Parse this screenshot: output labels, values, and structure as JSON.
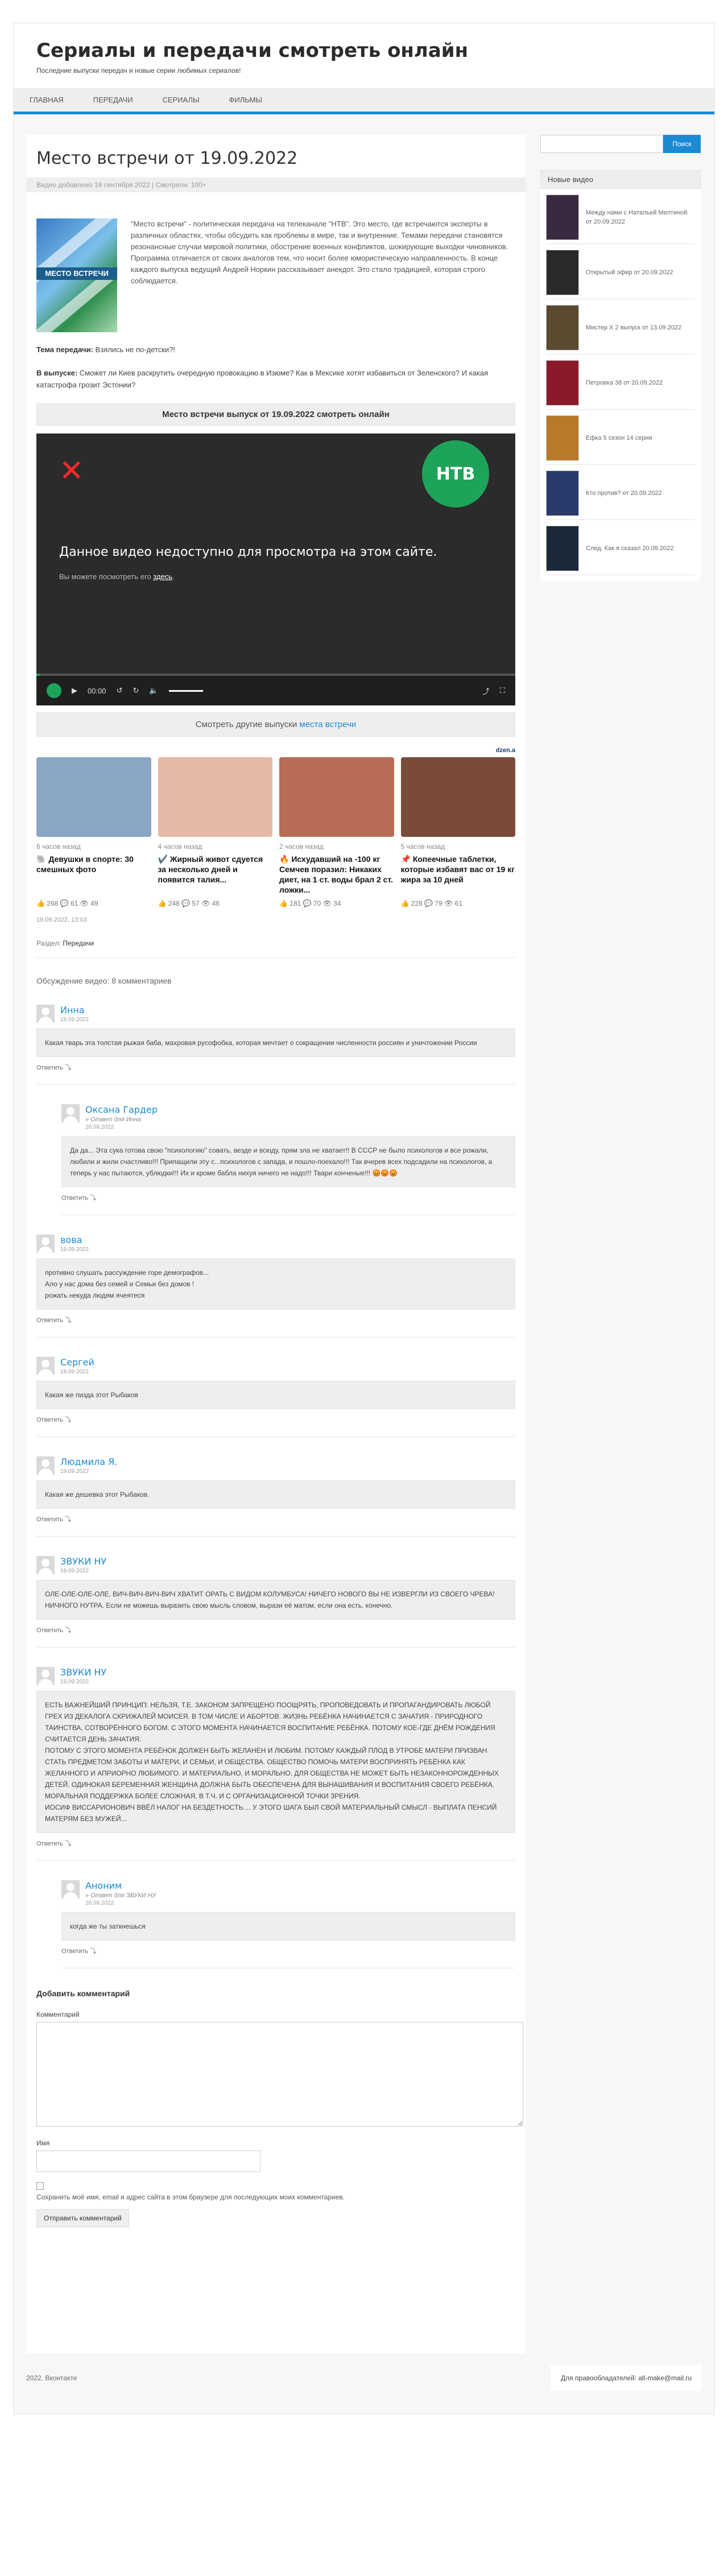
{
  "site": {
    "title": "Сериалы и передачи смотреть онлайн",
    "description": "Последние выпуски передач и новые серии любимых сериалов!"
  },
  "nav": [
    {
      "label": "Главная"
    },
    {
      "label": "Передачи"
    },
    {
      "label": "Сериалы"
    },
    {
      "label": "Фильмы"
    }
  ],
  "post": {
    "title": "Место встречи от 19.09.2022",
    "meta": "Видео добавлено 19 сентября 2022 | Смотрели: 100+",
    "poster_label": "МЕСТО ВСТРЕЧИ",
    "intro": "\"Место встречи\" - политическая передача на телеканале \"НТВ\". Это место, где встречаются эксперты в различных областях, чтобы обсудить как проблемы в мире, так и внутренние. Темами передачи становятся резонансные случаи мировой политики, обострение военных конфликтов, шокирующие выходки чиновников. Программа отличается от своих аналогов тем, что носит более юмористическую направленность. В конце каждого выпуска ведущий Андрей Норкин рассказывает анекдот. Это стало традицией, которая строго соблюдается.",
    "theme_label": "Тема передачи:",
    "theme_text": " Взялись не по-детски?!",
    "issue_label": "В выпуске:",
    "issue_text": " Сможет ли Киев раскрутить очередную провокацию в Изюме? Как в Мексике хотят избавиться от Зеленского? И какая катастрофа грозит Эстонии?",
    "watch_title": "Место встречи выпуск от 19.09.2022 смотреть онлайн",
    "player_logo": "НТВ",
    "player_message": "Данное видео недоступно для просмотра на этом сайте.",
    "player_sub": "Вы можете посмотреть его ",
    "player_sub_link": "здесь",
    "player_time": "00:00",
    "other_text": "Смотреть другие выпуски ",
    "other_link": "места встречи",
    "ad_label": "dzen.a",
    "date_line": "19.09.2022, 13:03",
    "section_label": "Раздел: ",
    "section_value": "Передачи"
  },
  "teasers": [
    {
      "time": "6 часов назад",
      "title": "🐘 Девушки в спорте: 30 смешных фото",
      "stats": "👍 268  💬 61  👁 49",
      "color": "#8aa6c4"
    },
    {
      "time": "4 часов назад",
      "title": "✔️ Жирный живот сдуется за несколько дней и появится талия...",
      "stats": "👍 248  💬 57  👁 46",
      "color": "#e6b8a8"
    },
    {
      "time": "2 часов назад",
      "title": "🔥 Исхудавший на -100 кг Семчев поразил: Никаких диет, на 1 ст. воды брал 2 ст. ложки...",
      "stats": "👍 181  💬 70  👁 34",
      "color": "#b86b55"
    },
    {
      "time": "5 часов назад",
      "title": "📌 Копеечные таблетки, которые избавят вас от 19 кг жира за 10 дней",
      "stats": "👍 228  💬 79  👁 61",
      "color": "#7a4b3a"
    }
  ],
  "comments_title": "Обсуждение видео: 8 комментариев",
  "comments": [
    {
      "name": "Инна",
      "reply_to": "",
      "date": "19.09.2022",
      "body": "Какая тварь эта толстая рыжая баба, махровая русофобка, которая мечтает о сокращении численности россиян и уничтожении России",
      "answer": "Ответить ⤵",
      "child": false
    },
    {
      "name": "Оксана Гардер",
      "reply_to": "» Ответ для Инна",
      "date": "20.09.2022",
      "body": "Да да... Эта сука готова свою \"психологию\" совать, везде и всюду, прям зла не хватает!! В СССР не было психологов и все рожали, любили и жили счастливо!!! Припащили эту с...психологов с запада, и пошло-поехало!!! Так вчерев всех подсадили на психологов, а теперь у нас пытаются, ублюдки!!! Их и кроме бабла нихуя ничего не надо!!! Твари конченые!!! 😡😡😡",
      "answer": "Ответить ⤵",
      "child": true
    },
    {
      "name": "вова",
      "reply_to": "",
      "date": "19.09.2022",
      "body": "противно слушать рассуждение горе демографов...\nАло у нас дома без семей и Семьи без домов !\nрожать некуда людям ячеятеся",
      "answer": "Ответить ⤵",
      "child": false
    },
    {
      "name": "Сергей",
      "reply_to": "",
      "date": "19.09.2022",
      "body": "Какая же пизда этот Рыбаков",
      "answer": "Ответить ⤵",
      "child": false
    },
    {
      "name": "Людмила Я.",
      "reply_to": "",
      "date": "19.09.2022",
      "body": "Какая же дешевка этот Рыбаков.",
      "answer": "Ответить ⤵",
      "child": false
    },
    {
      "name": "ЗВУКИ НУ",
      "reply_to": "",
      "date": "19.09.2022",
      "body": "ОЛЕ-ОЛЕ-ОЛЕ-ОЛЕ, ВИЧ-ВИЧ-ВИЧ-ВИЧ ХВАТИТ ОРАТЬ С ВИДОМ КОЛУМБУСА! НИЧЕГО НОВОГО ВЫ НЕ ИЗВЕРГЛИ ИЗ СВОЕГО ЧРЕВА! \nНИЧНОГО НУТРА. Если не можешь выразить свою мысль словом, вырази её матом, если она есть, конечно.",
      "answer": "Ответить ⤵",
      "child": false
    },
    {
      "name": "ЗВУКИ НУ",
      "reply_to": "",
      "date": "19.09.2022",
      "body": "ЕСТЬ ВАЖНЕЙШИЙ ПРИНЦИП: НЕЛЬЗЯ, Т.Е. ЗАКОНОМ ЗАПРЕЩЕНО ПООЩРЯТЬ, ПРОПОВЕДОВАТЬ И ПРОПАГАНДИРОВАТЬ ЛЮБОЙ ГРЕХ ИЗ ДЕКАЛОГА СКРИЖАЛЕЙ МОИСЕЯ. В ТОМ ЧИСЛЕ И АБОРТОВ. ЖИЗНЬ РЕБЁНКА НАЧИНАЕТСЯ С ЗАЧАТИЯ - ПРИРОДНОГО ТАИНСТВА, СОТВОРЁННОГО БОГОМ. С ЭТОГО МОМЕНТА НАЧИНАЕТСЯ ВОСПИТАНИЕ РЕБЁНКА. ПОТОМУ КОЕ-ГДЕ ДНЁМ РОЖДЕНИЯ СЧИТАЕТСЯ ДЕНЬ ЗАЧАТИЯ.\nПОТОМУ С ЭТОГО МОМЕНТА РЕБЁНОК ДОЛЖЕН БЫТЬ ЖЕЛАНЕН И ЛЮБИМ. ПОТОМУ КАЖДЫЙ ПЛОД В УТРОБЕ МАТЕРИ ПРИЗВАН СТАТЬ ПРЕДМЕТОМ ЗАБОТЫ И МАТЕРИ, И СЕМЬИ, И ОБЩЕСТВА. ОБЩЕСТВО ПОМОЧЬ МАТЕРИ ВОСПРИНЯТЬ РЕБЁНКА КАК ЖЕЛАННОГО И АПРИОРНО ЛЮБИМОГО. И МАТЕРИАЛЬНО, И МОРАЛЬНО. ДЛЯ ОБЩЕСТВА НЕ МОЖЕТ БЫТЬ НЕЗАКОННОРОЖДЕННЫХ ДЕТЕЙ. ОДИНОКАЯ БЕРЕМЕННАЯ ЖЕНЩИНА ДОЛЖНА БЫТЬ ОБЕСПЕЧЕНА ДЛЯ ВЫНАШИВАНИЯ И ВОСПИТАНИЯ СВОЕГО РЕБЁНКА. МОРАЛЬНАЯ ПОДДЕРЖКА БОЛЕЕ СЛОЖНАЯ, В Т.Ч. И С ОРГАНИЗАЦИОННОЙ ТОЧКИ ЗРЕНИЯ.\nИОСИФ ВИССАРИОНОВИЧ ВВЁЛ НАЛОГ НА БЕЗДЕТНОСТЬ.... У ЭТОГО ШАГА БЫЛ СВОЙ МАТЕРИАЛЬНЫЙ СМЫСЛ - ВЫПЛАТА ПЕНСИЙ МАТЕРЯМ БЕЗ МУЖЕЙ...",
      "answer": "Ответить ⤵",
      "child": false
    },
    {
      "name": "Аноним",
      "reply_to": "» Ответ для ЗВУКИ НУ",
      "date": "20.09.2022",
      "body": "когда же ты заткнешься",
      "answer": "Ответить ⤵",
      "child": true
    }
  ],
  "form": {
    "title": "Добавить комментарий",
    "comment_label": "Комментарий",
    "name_label": "Имя",
    "save_label": "Сохранить моё имя, email и адрес сайта в этом браузере для последующих моих комментариев.",
    "submit_label": "Отправить комментарий"
  },
  "sidebar": {
    "search_button": "Поиск",
    "widget_title": "Новые видео",
    "videos": [
      {
        "title": "Между нами с Натальей Мелтиной от 20.09.2022",
        "color": "#3a2a40"
      },
      {
        "title": "Открытый эфир от 20.09.2022",
        "color": "#2a2a2a"
      },
      {
        "title": "Мистер X 2 выпуск от 13.09.2022",
        "color": "#5a4a30"
      },
      {
        "title": "Петровка 38 от 20.09.2022",
        "color": "#8a1a2a"
      },
      {
        "title": "Ефка 5 сезон 14 серия",
        "color": "#b87a2a"
      },
      {
        "title": "Кто против? от 20.09.2022",
        "color": "#2a3a6a"
      },
      {
        "title": "След. Как я сказал 20.09.2022",
        "color": "#1a2a3a"
      }
    ]
  },
  "footer": {
    "left": "2022.  Вконтакте",
    "right": "Для правообладателей: all-make@mail.ru"
  },
  "colors": {
    "accent": "#1b8ad3",
    "ntv_green": "#1ea45a",
    "player_bg": "#2b2b2b"
  }
}
